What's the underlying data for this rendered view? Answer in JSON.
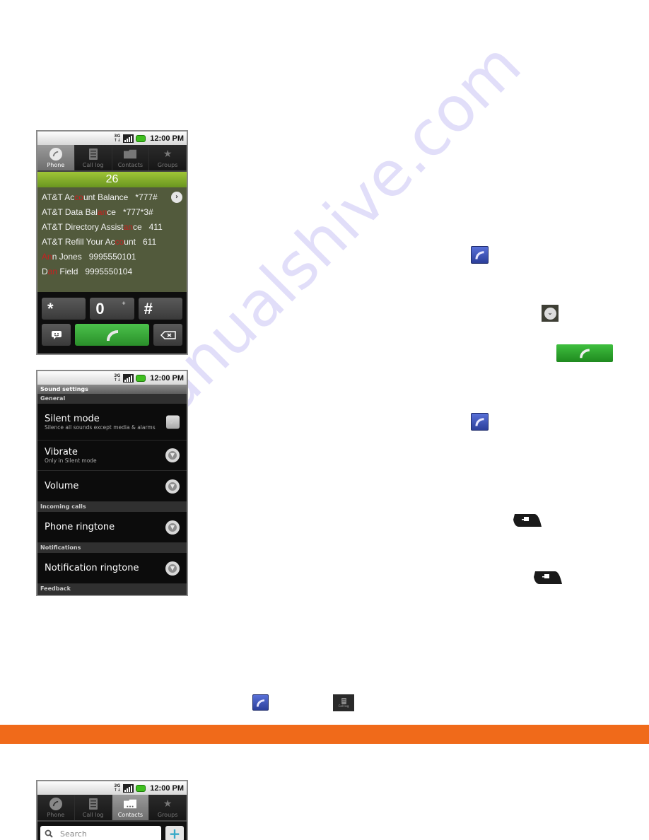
{
  "status_bar": {
    "network": "3G",
    "time": "12:00 PM"
  },
  "tabs": [
    {
      "label": "Phone",
      "icon": "phone-icon"
    },
    {
      "label": "Call log",
      "icon": "call-log-icon"
    },
    {
      "label": "Contacts",
      "icon": "contacts-icon"
    },
    {
      "label": "Groups",
      "icon": "star-icon"
    }
  ],
  "dialer": {
    "active_tab": "Phone",
    "digits": "26",
    "matches": [
      {
        "pre": "AT&T Ac",
        "hl": "co",
        "post": "unt Balance   *777#"
      },
      {
        "pre": "AT&T Data Bal",
        "hl": "an",
        "post": "ce   *777*3#"
      },
      {
        "pre": "AT&T Directory Assist",
        "hl": "an",
        "post": "ce   411"
      },
      {
        "pre": "AT&T Refill Your Ac",
        "hl": "co",
        "post": "unt   611"
      },
      {
        "pre": "",
        "hl": "An",
        "post": "n Jones   9995550101"
      },
      {
        "pre": "D",
        "hl": "an",
        "post": " Field   9995550104"
      }
    ],
    "keys": {
      "star": "*",
      "zero": "0",
      "plus": "+",
      "hash": "#"
    }
  },
  "sound_settings": {
    "title": "Sound settings",
    "sections": {
      "general": "General",
      "incoming": "Incoming calls",
      "notifications": "Notifications",
      "feedback": "Feedback"
    },
    "items": {
      "silent_mode": {
        "title": "Silent mode",
        "subtitle": "Silence all sounds except media & alarms",
        "checked": true
      },
      "vibrate": {
        "title": "Vibrate",
        "subtitle": "Only in Silent mode"
      },
      "volume": {
        "title": "Volume"
      },
      "phone_ringtone": {
        "title": "Phone ringtone"
      },
      "notification_ringtone": {
        "title": "Notification ringtone"
      }
    }
  },
  "contacts": {
    "active_tab": "Contacts",
    "search_placeholder": "Search",
    "add_label": "+"
  },
  "inline_icons": {
    "call_log_label": "Call log"
  },
  "colors": {
    "accent_orange": "#f06a1a",
    "dialer_green": "#7aa92a",
    "call_green": "#2fa52f",
    "highlight_red": "#c62020"
  },
  "watermark": "manualshive.com"
}
